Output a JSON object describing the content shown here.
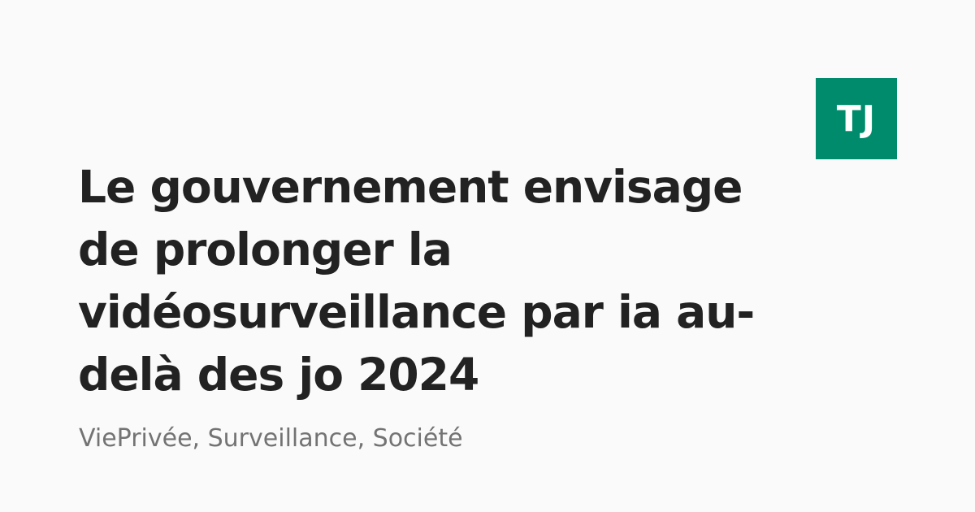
{
  "logo": {
    "text": "TJ",
    "background_color": "#008c6c"
  },
  "article": {
    "title_lines": [
      "Le gouvernement envisage",
      "de prolonger la",
      "vidéosurveillance par ia au-",
      "delà des jo 2024"
    ],
    "tags": "ViePrivée, Surveillance, Société"
  }
}
